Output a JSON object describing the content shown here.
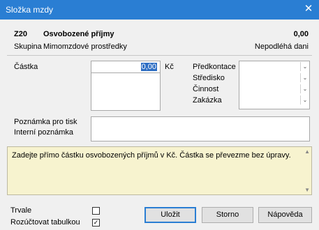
{
  "window": {
    "title": "Složka mzdy",
    "close_glyph": "✕"
  },
  "header": {
    "code": "Z20",
    "name": "Osvobozené příjmy",
    "amount": "0,00",
    "group_label": "Skupina",
    "group_value": "Mimomzdové prostředky",
    "tax_status": "Nepodléhá dani"
  },
  "form": {
    "amount_label": "Částka",
    "amount_value": "0,00",
    "currency": "Kč",
    "right_labels": [
      "Předkontace",
      "Středisko",
      "Činnost",
      "Zakázka"
    ],
    "print_note_label": "Poznámka pro tisk",
    "internal_note_label": "Interní poznámka"
  },
  "info_text": "Zadejte přímo částku osvobozených příjmů v Kč. Částka se převezme bez úpravy.",
  "options": {
    "permanent_label": "Trvale",
    "permanent_checked": false,
    "table_label": "Rozúčtovat tabulkou",
    "table_checked": true
  },
  "buttons": {
    "save": "Uložit",
    "cancel": "Storno",
    "help": "Nápověda"
  }
}
